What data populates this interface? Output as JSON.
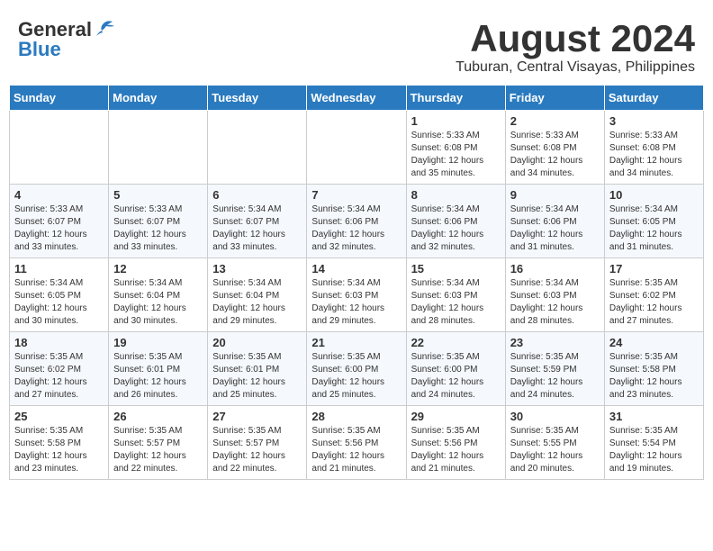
{
  "header": {
    "logo_general": "General",
    "logo_blue": "Blue",
    "month_title": "August 2024",
    "subtitle": "Tuburan, Central Visayas, Philippines"
  },
  "days_of_week": [
    "Sunday",
    "Monday",
    "Tuesday",
    "Wednesday",
    "Thursday",
    "Friday",
    "Saturday"
  ],
  "weeks": [
    [
      {
        "day": "",
        "info": ""
      },
      {
        "day": "",
        "info": ""
      },
      {
        "day": "",
        "info": ""
      },
      {
        "day": "",
        "info": ""
      },
      {
        "day": "1",
        "info": "Sunrise: 5:33 AM\nSunset: 6:08 PM\nDaylight: 12 hours\nand 35 minutes."
      },
      {
        "day": "2",
        "info": "Sunrise: 5:33 AM\nSunset: 6:08 PM\nDaylight: 12 hours\nand 34 minutes."
      },
      {
        "day": "3",
        "info": "Sunrise: 5:33 AM\nSunset: 6:08 PM\nDaylight: 12 hours\nand 34 minutes."
      }
    ],
    [
      {
        "day": "4",
        "info": "Sunrise: 5:33 AM\nSunset: 6:07 PM\nDaylight: 12 hours\nand 33 minutes."
      },
      {
        "day": "5",
        "info": "Sunrise: 5:33 AM\nSunset: 6:07 PM\nDaylight: 12 hours\nand 33 minutes."
      },
      {
        "day": "6",
        "info": "Sunrise: 5:34 AM\nSunset: 6:07 PM\nDaylight: 12 hours\nand 33 minutes."
      },
      {
        "day": "7",
        "info": "Sunrise: 5:34 AM\nSunset: 6:06 PM\nDaylight: 12 hours\nand 32 minutes."
      },
      {
        "day": "8",
        "info": "Sunrise: 5:34 AM\nSunset: 6:06 PM\nDaylight: 12 hours\nand 32 minutes."
      },
      {
        "day": "9",
        "info": "Sunrise: 5:34 AM\nSunset: 6:06 PM\nDaylight: 12 hours\nand 31 minutes."
      },
      {
        "day": "10",
        "info": "Sunrise: 5:34 AM\nSunset: 6:05 PM\nDaylight: 12 hours\nand 31 minutes."
      }
    ],
    [
      {
        "day": "11",
        "info": "Sunrise: 5:34 AM\nSunset: 6:05 PM\nDaylight: 12 hours\nand 30 minutes."
      },
      {
        "day": "12",
        "info": "Sunrise: 5:34 AM\nSunset: 6:04 PM\nDaylight: 12 hours\nand 30 minutes."
      },
      {
        "day": "13",
        "info": "Sunrise: 5:34 AM\nSunset: 6:04 PM\nDaylight: 12 hours\nand 29 minutes."
      },
      {
        "day": "14",
        "info": "Sunrise: 5:34 AM\nSunset: 6:03 PM\nDaylight: 12 hours\nand 29 minutes."
      },
      {
        "day": "15",
        "info": "Sunrise: 5:34 AM\nSunset: 6:03 PM\nDaylight: 12 hours\nand 28 minutes."
      },
      {
        "day": "16",
        "info": "Sunrise: 5:34 AM\nSunset: 6:03 PM\nDaylight: 12 hours\nand 28 minutes."
      },
      {
        "day": "17",
        "info": "Sunrise: 5:35 AM\nSunset: 6:02 PM\nDaylight: 12 hours\nand 27 minutes."
      }
    ],
    [
      {
        "day": "18",
        "info": "Sunrise: 5:35 AM\nSunset: 6:02 PM\nDaylight: 12 hours\nand 27 minutes."
      },
      {
        "day": "19",
        "info": "Sunrise: 5:35 AM\nSunset: 6:01 PM\nDaylight: 12 hours\nand 26 minutes."
      },
      {
        "day": "20",
        "info": "Sunrise: 5:35 AM\nSunset: 6:01 PM\nDaylight: 12 hours\nand 25 minutes."
      },
      {
        "day": "21",
        "info": "Sunrise: 5:35 AM\nSunset: 6:00 PM\nDaylight: 12 hours\nand 25 minutes."
      },
      {
        "day": "22",
        "info": "Sunrise: 5:35 AM\nSunset: 6:00 PM\nDaylight: 12 hours\nand 24 minutes."
      },
      {
        "day": "23",
        "info": "Sunrise: 5:35 AM\nSunset: 5:59 PM\nDaylight: 12 hours\nand 24 minutes."
      },
      {
        "day": "24",
        "info": "Sunrise: 5:35 AM\nSunset: 5:58 PM\nDaylight: 12 hours\nand 23 minutes."
      }
    ],
    [
      {
        "day": "25",
        "info": "Sunrise: 5:35 AM\nSunset: 5:58 PM\nDaylight: 12 hours\nand 23 minutes."
      },
      {
        "day": "26",
        "info": "Sunrise: 5:35 AM\nSunset: 5:57 PM\nDaylight: 12 hours\nand 22 minutes."
      },
      {
        "day": "27",
        "info": "Sunrise: 5:35 AM\nSunset: 5:57 PM\nDaylight: 12 hours\nand 22 minutes."
      },
      {
        "day": "28",
        "info": "Sunrise: 5:35 AM\nSunset: 5:56 PM\nDaylight: 12 hours\nand 21 minutes."
      },
      {
        "day": "29",
        "info": "Sunrise: 5:35 AM\nSunset: 5:56 PM\nDaylight: 12 hours\nand 21 minutes."
      },
      {
        "day": "30",
        "info": "Sunrise: 5:35 AM\nSunset: 5:55 PM\nDaylight: 12 hours\nand 20 minutes."
      },
      {
        "day": "31",
        "info": "Sunrise: 5:35 AM\nSunset: 5:54 PM\nDaylight: 12 hours\nand 19 minutes."
      }
    ]
  ]
}
